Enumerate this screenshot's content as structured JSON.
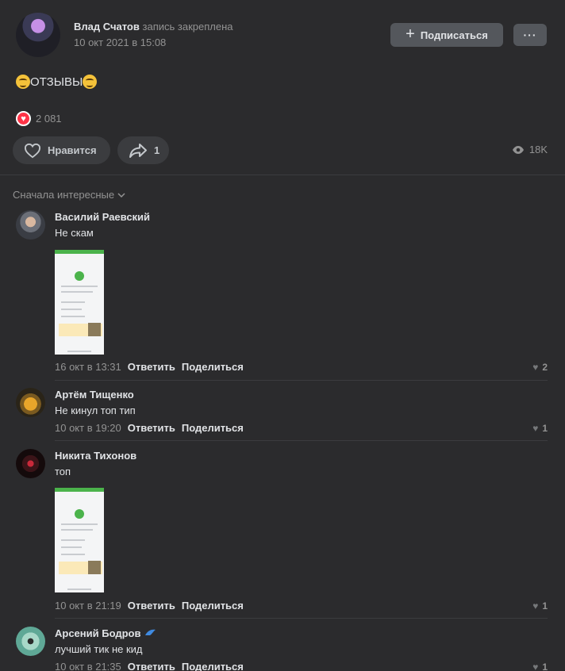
{
  "post": {
    "author": "Влад Счатов",
    "pinned_note": "запись закреплена",
    "date": "10 окт 2021 в 15:08",
    "subscribe_label": "Подписаться",
    "more_label": "···",
    "text": "ОТЗЫВЫ",
    "reactions_count": "2 081",
    "like_label": "Нравится",
    "share_count": "1",
    "views": "18K"
  },
  "comments_sort": "Сначала интересные",
  "comments": [
    {
      "name": "Василий Раевский",
      "text": "Не скам",
      "date": "16 окт в 13:31",
      "reply": "Ответить",
      "share": "Поделиться",
      "likes": "2"
    },
    {
      "name": "Артём Тищенко",
      "text": "Не кинул топ тип",
      "date": "10 окт в 19:20",
      "reply": "Ответить",
      "share": "Поделиться",
      "likes": "1"
    },
    {
      "name": "Никита Тихонов",
      "text": "топ",
      "date": "10 окт в 21:19",
      "reply": "Ответить",
      "share": "Поделиться",
      "likes": "1"
    },
    {
      "name": "Арсений Бодров",
      "text": "лучший тик не кид",
      "date": "10 окт в 21:35",
      "reply": "Ответить",
      "share": "Поделиться",
      "likes": "1"
    }
  ],
  "colors": {
    "background": "#2b2b2d",
    "button": "#54575c",
    "like_heart": "#ff3347",
    "accent_green": "#4bb34b"
  }
}
